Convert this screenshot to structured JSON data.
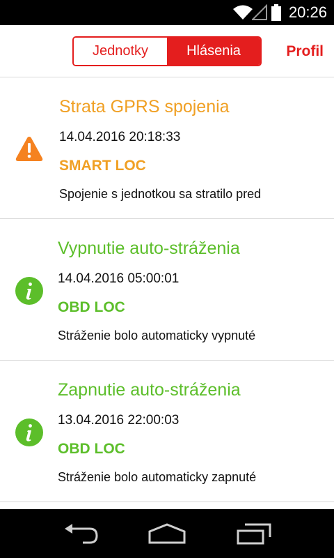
{
  "status_bar": {
    "time": "20:26",
    "icons": [
      "wifi-icon",
      "signal-icon",
      "battery-icon"
    ]
  },
  "header": {
    "tabs": [
      {
        "label": "Jednotky",
        "active": false
      },
      {
        "label": "Hlásenia",
        "active": true
      }
    ],
    "profile_label": "Profil",
    "accent_color": "#e41e1e"
  },
  "notifications": [
    {
      "icon": "warning-icon",
      "color": "#f0a024",
      "title": "Strata GPRS spojenia",
      "datetime": "14.04.2016 20:18:33",
      "unit": "SMART LOC",
      "message": "Spojenie s jednotkou sa stratilo pred"
    },
    {
      "icon": "info-icon",
      "color": "#5cbe2a",
      "title": "Vypnutie auto-stráženia",
      "datetime": "14.04.2016 05:00:01",
      "unit": "OBD LOC",
      "message": "Stráženie bolo automaticky vypnuté"
    },
    {
      "icon": "info-icon",
      "color": "#5cbe2a",
      "title": "Zapnutie auto-stráženia",
      "datetime": "13.04.2016 22:00:03",
      "unit": "OBD LOC",
      "message": "Stráženie bolo automaticky zapnuté"
    }
  ],
  "nav_bar": {
    "buttons": [
      "back-icon",
      "home-icon",
      "recent-apps-icon"
    ]
  }
}
